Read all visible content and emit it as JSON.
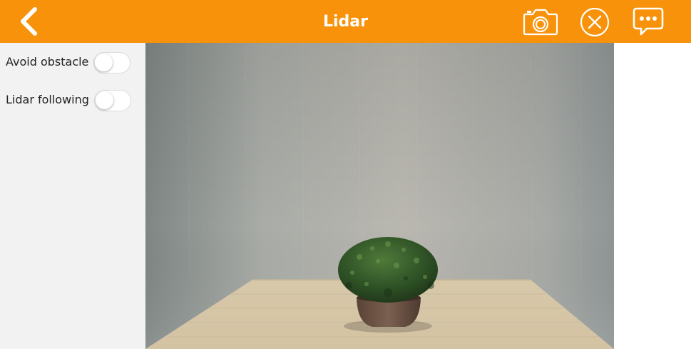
{
  "header": {
    "title": "Lidar",
    "background_color": "#F7920A",
    "back_icon": "chevron-left-icon",
    "camera_icon": "camera-icon",
    "close_icon": "close-circle-icon",
    "chat_icon": "chat-bubble-icon"
  },
  "sidebar": {
    "toggles": [
      {
        "label": "Avoid obstacle",
        "on": false
      },
      {
        "label": "Lidar following",
        "on": false
      }
    ]
  },
  "camera_feed": {
    "scene": "potted-plant-on-wooden-table"
  }
}
